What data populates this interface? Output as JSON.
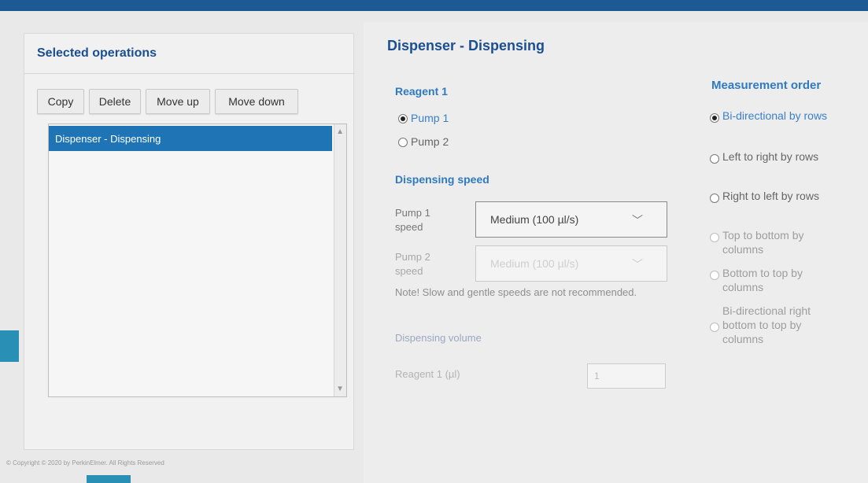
{
  "left_panel": {
    "title": "Selected operations",
    "buttons": {
      "copy": "Copy",
      "delete": "Delete",
      "move_up": "Move up",
      "move_down": "Move down"
    },
    "list_items": [
      "Dispenser - Dispensing"
    ]
  },
  "footer": {
    "copyright": "© Copyright © 2020 by PerkinElmer. All Rights Reserved"
  },
  "right_panel": {
    "title": "Dispenser - Dispensing",
    "reagent": {
      "heading": "Reagent 1",
      "options": [
        "Pump 1",
        "Pump 2"
      ],
      "selected": "Pump 1"
    },
    "dispensing_speed": {
      "heading": "Dispensing speed",
      "pump1_label": "Pump 1 speed",
      "pump1_value": "Medium (100 µl/s)",
      "pump2_label": "Pump 2 speed",
      "pump2_value": "Medium (100 µl/s)",
      "note": "Note! Slow and gentle speeds are not recommended."
    },
    "dispensing_volume": {
      "heading": "Dispensing volume",
      "reagent_label": "Reagent 1 (µl)",
      "reagent_value": "1"
    },
    "measurement_order": {
      "heading": "Measurement order",
      "options": [
        "Bi-directional by rows",
        "Left to right by rows",
        "Right to left by rows",
        "Top to bottom by columns",
        "Bottom to top by columns",
        "Bi-directional right bottom to top by columns"
      ],
      "selected_index": 0
    }
  },
  "colors": {
    "accent": "#1f74b6",
    "heading": "#1c4f8f",
    "topbar": "#1d5a93"
  }
}
